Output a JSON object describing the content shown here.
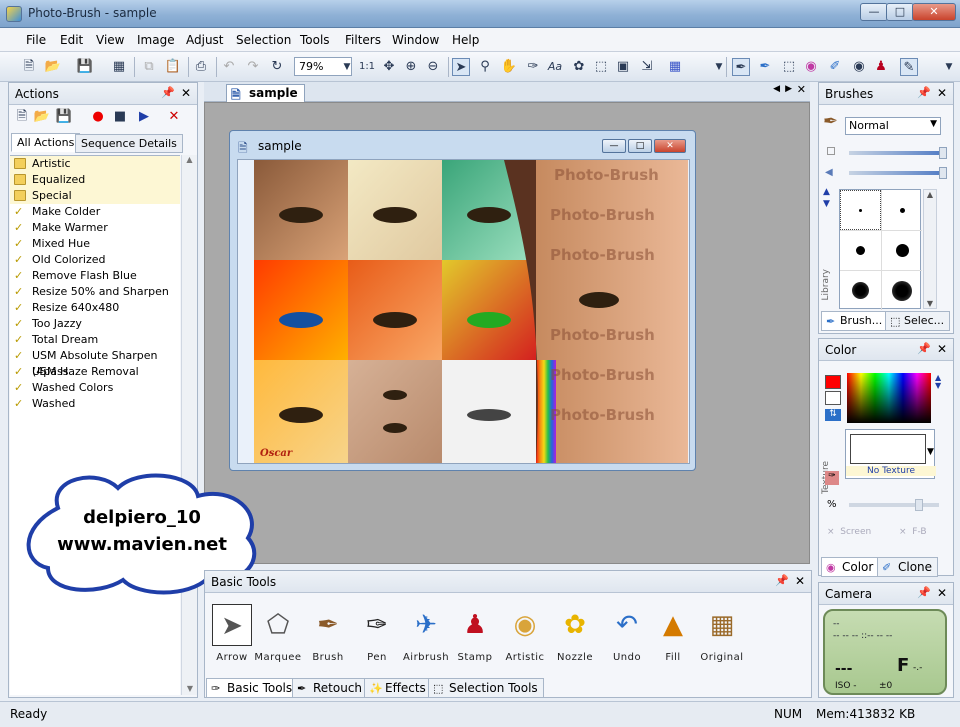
{
  "window": {
    "title": "Photo-Brush - sample"
  },
  "menu": [
    "File",
    "Edit",
    "View",
    "Image",
    "Adjust",
    "Selection",
    "Tools",
    "Filters",
    "Window",
    "Help"
  ],
  "toolbar": {
    "zoom": "79%",
    "ratio": "1:1"
  },
  "actions": {
    "title": "Actions",
    "tabs": [
      "All Actions",
      "Sequence Details"
    ],
    "folders": [
      "Artistic",
      "Equalized",
      "Special"
    ],
    "items": [
      "Make Colder",
      "Make Warmer",
      "Mixed Hue",
      "Old Colorized",
      "Remove Flash Blue",
      "Resize 50% and Sharpen",
      "Resize 640x480",
      "Too Jazzy",
      "Total Dream",
      "USM Absolute Sharpen (4pass",
      "USM Haze Removal",
      "Washed Colors",
      "Washed"
    ]
  },
  "document": {
    "tab": "sample",
    "window_title": "sample",
    "signature": "Oscar",
    "watermark": "Photo-Brush"
  },
  "brushes": {
    "title": "Brushes",
    "blend_mode": "Normal",
    "library_label": "Library",
    "tabs": [
      "Brush...",
      "Selec..."
    ]
  },
  "color": {
    "title": "Color",
    "texture_label": "Texture",
    "no_texture": "No Texture",
    "percent": "%",
    "screen": "Screen",
    "fb": "F-B",
    "tabs": [
      "Color",
      "Clone"
    ],
    "primary": "#ff0000",
    "secondary": "#ffffff"
  },
  "camera": {
    "title": "Camera",
    "line1": "--",
    "line2": "-- -- -- ::-- -- --",
    "shots": "---",
    "flag": "F",
    "flag_sub": "-.-",
    "iso": "ISO -",
    "ev": "±0"
  },
  "basic_tools": {
    "title": "Basic Tools",
    "tools": [
      {
        "label": "Arrow",
        "icon": "arrow-icon"
      },
      {
        "label": "Marquee",
        "icon": "marquee-icon"
      },
      {
        "label": "Brush",
        "icon": "brush-icon"
      },
      {
        "label": "Pen",
        "icon": "pen-icon"
      },
      {
        "label": "Airbrush",
        "icon": "airbrush-icon"
      },
      {
        "label": "Stamp",
        "icon": "stamp-icon"
      },
      {
        "label": "Artistic",
        "icon": "palette-icon"
      },
      {
        "label": "Nozzle",
        "icon": "nozzle-icon"
      },
      {
        "label": "Undo",
        "icon": "undo-icon"
      },
      {
        "label": "Fill",
        "icon": "fill-icon"
      },
      {
        "label": "Original",
        "icon": "original-icon"
      }
    ],
    "tabs": [
      "Basic Tools",
      "Retouch",
      "Effects",
      "Selection Tools"
    ]
  },
  "cloud": {
    "line1": "delpiero_10",
    "line2": "www.mavien.net"
  },
  "status": {
    "left": "Ready",
    "num": "NUM",
    "mem": "Mem:413832 KB"
  }
}
